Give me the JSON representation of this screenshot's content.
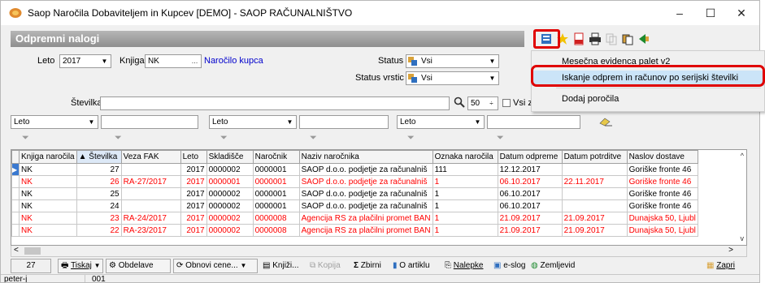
{
  "window": {
    "title": "Saop Naročila Dobaviteljem in Kupcev [DEMO] - SAOP RAČUNALNIŠTVO",
    "minimize": "–",
    "maximize": "☐",
    "close": "✕"
  },
  "header": {
    "title": "Odpremni nalogi"
  },
  "filters": {
    "leto_label": "Leto",
    "leto_value": "2017",
    "knjiga_label": "Knjiga",
    "knjiga_value": "NK",
    "knjiga_link": "Naročilo kupca",
    "status_label": "Status",
    "status_value": "Vsi",
    "status_vrstic_label": "Status vrstic",
    "status_vrstic_value": "Vsi",
    "stevilka_label": "Številka",
    "count_value": "50",
    "vsi_label": "Vsi z",
    "col_filter_1": "Leto",
    "col_filter_2": "Leto",
    "col_filter_3": "Leto",
    "ellipsis": "…"
  },
  "menu": {
    "items": [
      "Mesečna evidenca palet v2",
      "Iskanje odprem in računov po serijski številki",
      "Dodaj poročila"
    ]
  },
  "table": {
    "columns": [
      "Knjiga naročila",
      "▲ Številka",
      "Veza FAK",
      "Leto",
      "Skladišče",
      "Naročnik",
      "Naziv naročnika",
      "Oznaka naročila",
      "Datum odpreme",
      "Datum potrditve",
      "Naslov dostave"
    ],
    "rows": [
      [
        "NK",
        "27",
        "",
        "2017",
        "0000002",
        "0000001",
        "SAOP d.o.o. podjetje za računalniš",
        "111",
        "12.12.2017",
        "",
        "Goriške fronte 46"
      ],
      [
        "NK",
        "26",
        "RA-27/2017",
        "2017",
        "0000001",
        "0000001",
        "SAOP d.o.o. podjetje za računalniš",
        "1",
        "06.10.2017",
        "22.11.2017",
        "Goriške fronte 46"
      ],
      [
        "NK",
        "25",
        "",
        "2017",
        "0000002",
        "0000001",
        "SAOP d.o.o. podjetje za računalniš",
        "1",
        "06.10.2017",
        "",
        "Goriške fronte 46"
      ],
      [
        "NK",
        "24",
        "",
        "2017",
        "0000002",
        "0000001",
        "SAOP d.o.o. podjetje za računalniš",
        "1",
        "06.10.2017",
        "",
        "Goriške fronte 46"
      ],
      [
        "NK",
        "23",
        "RA-24/2017",
        "2017",
        "0000002",
        "0000008",
        "Agencija RS za plačilni promet BAN",
        "1",
        "21.09.2017",
        "21.09.2017",
        "Dunajska 50, Ljubl"
      ],
      [
        "NK",
        "22",
        "RA-23/2017",
        "2017",
        "0000002",
        "0000008",
        "Agencija RS za plačilni promet BAN",
        "1",
        "21.09.2017",
        "21.09.2017",
        "Dunajska 50, Ljubl"
      ]
    ]
  },
  "bottom": {
    "count": "27",
    "tiskaj": "Tiskaj",
    "obdelave": "Obdelave",
    "obnovi": "Obnovi cene...",
    "knjizi": "Knjiži...",
    "kopija": "Kopija",
    "zbirni": "Zbirni",
    "oartiklu": "O artiklu",
    "nalepke": "Nalepke",
    "eslog": "e-slog",
    "zemljevid": "Zemljevid",
    "zapri": "Zapri"
  },
  "status": {
    "user": "peter-j",
    "code": "001"
  },
  "colors": {
    "accent_red": "#e00000",
    "row_red": "#ff0000",
    "highlight": "#cbe4f8",
    "selection": "#3a79d0"
  }
}
